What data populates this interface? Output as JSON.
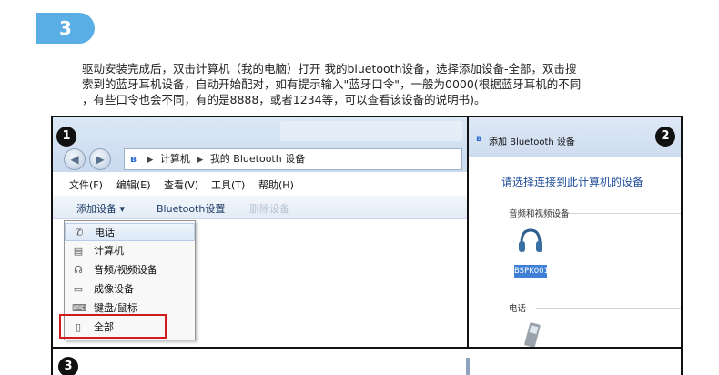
{
  "step": {
    "number": "3"
  },
  "intro": {
    "line1": "驱动安装完成后，双击计算机（我的电脑）打开 我的bluetooth设备，选择添加设备-全部，双击搜",
    "line2": "索到的蓝牙耳机设备，自动开始配对，如有提示输入\"蓝牙口令\"，一般为0000(根据蓝牙耳机的不同",
    "line3": "，有些口令也会不同，有的是8888，或者1234等，可以查看该设备的说明书)。"
  },
  "panel1": {
    "marker": "1",
    "address": {
      "bt_icon": "ʙ",
      "sep": "▶",
      "computer": "计算机",
      "folder": "我的 Bluetooth 设备"
    },
    "menu": {
      "file": "文件(F)",
      "edit": "编辑(E)",
      "view": "查看(V)",
      "tools": "工具(T)",
      "help": "帮助(H)"
    },
    "toolbar": {
      "add": "添加设备 ▾",
      "bluetooth_settings": "Bluetooth设置",
      "delete": "删除设备"
    },
    "dropdown": [
      {
        "label": "电话",
        "icon": "phone-icon"
      },
      {
        "label": "计算机",
        "icon": "computer-icon"
      },
      {
        "label": "音频/视频设备",
        "icon": "headphones-icon"
      },
      {
        "label": "成像设备",
        "icon": "scanner-icon"
      },
      {
        "label": "键盘/鼠标",
        "icon": "keyboard-icon"
      },
      {
        "label": "全部",
        "icon": "all-devices-icon"
      }
    ]
  },
  "panel2": {
    "marker": "2",
    "title": "添加 Bluetooth 设备",
    "heading": "请选择连接到此计算机的设备",
    "section_av": "音频和视频设备",
    "device_name": "BSPK001",
    "section_phone": "电话"
  },
  "panel3": {
    "marker": "3"
  },
  "colors": {
    "badge": "#5aaee6",
    "highlight_box": "#d11b1b",
    "selected_device": "#3f7fd6"
  }
}
